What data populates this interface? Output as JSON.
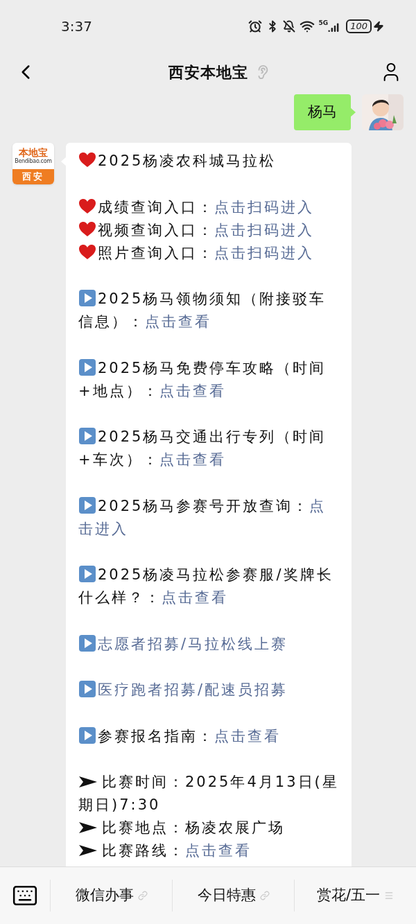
{
  "status_bar": {
    "time": "3:37",
    "network": "5G",
    "battery": "100"
  },
  "header": {
    "title": "西安本地宝"
  },
  "messages": [
    {
      "kind": "sent",
      "text": "杨马"
    },
    {
      "kind": "received",
      "avatar": {
        "brand": "本地宝",
        "domain": "Bendibao.com",
        "city": "西安"
      },
      "blocks": [
        [
          {
            "kind": "heart",
            "parts": [
              {
                "text": "2025杨凌农科城马拉松",
                "link": false
              }
            ]
          }
        ],
        [
          {
            "kind": "heart",
            "parts": [
              {
                "text": "成绩查询入口：",
                "link": false
              },
              {
                "text": "点击扫码进入",
                "link": true
              }
            ]
          },
          {
            "kind": "heart",
            "parts": [
              {
                "text": "视频查询入口：",
                "link": false
              },
              {
                "text": "点击扫码进入",
                "link": true
              }
            ]
          },
          {
            "kind": "heart",
            "parts": [
              {
                "text": "照片查询入口：",
                "link": false
              },
              {
                "text": "点击扫码进入",
                "link": true
              }
            ]
          }
        ],
        [
          {
            "kind": "play",
            "parts": [
              {
                "text": "2025杨马领物须知（附接驳车",
                "link": false
              }
            ]
          },
          {
            "kind": "continuation",
            "parts": [
              {
                "text": "信息）：",
                "link": false
              },
              {
                "text": "点击查看",
                "link": true
              }
            ]
          }
        ],
        [
          {
            "kind": "play",
            "parts": [
              {
                "text": "2025杨马免费停车攻略（时间",
                "link": false
              }
            ]
          },
          {
            "kind": "continuation",
            "parts": [
              {
                "text": "+地点）：",
                "link": false
              },
              {
                "text": "点击查看",
                "link": true
              }
            ]
          }
        ],
        [
          {
            "kind": "play",
            "parts": [
              {
                "text": "2025杨马交通出行专列（时间",
                "link": false
              }
            ]
          },
          {
            "kind": "continuation",
            "parts": [
              {
                "text": "+车次）：",
                "link": false
              },
              {
                "text": "点击查看",
                "link": true
              }
            ]
          }
        ],
        [
          {
            "kind": "play",
            "parts": [
              {
                "text": "2025杨马参赛号开放查询：",
                "link": false
              },
              {
                "text": "点",
                "link": true
              }
            ]
          },
          {
            "kind": "continuation",
            "parts": [
              {
                "text": "击进入",
                "link": true
              }
            ]
          }
        ],
        [
          {
            "kind": "play",
            "parts": [
              {
                "text": "2025杨凌马拉松参赛服/奖牌长",
                "link": false
              }
            ]
          },
          {
            "kind": "continuation",
            "parts": [
              {
                "text": "什么样？：",
                "link": false
              },
              {
                "text": "点击查看",
                "link": true
              }
            ]
          }
        ],
        [
          {
            "kind": "play",
            "parts": [
              {
                "text": "志愿者招募/马拉松线上赛",
                "link": true
              }
            ]
          }
        ],
        [
          {
            "kind": "play",
            "parts": [
              {
                "text": "医疗跑者招募/配速员招募",
                "link": true
              }
            ]
          }
        ],
        [
          {
            "kind": "play",
            "parts": [
              {
                "text": "参赛报名指南：",
                "link": false
              },
              {
                "text": "点击查看",
                "link": true
              }
            ]
          }
        ],
        [
          {
            "kind": "arrow",
            "parts": [
              {
                "text": "比赛时间：2025年4月13日(星",
                "link": false
              }
            ]
          },
          {
            "kind": "continuation",
            "parts": [
              {
                "text": "期日)7:30",
                "link": false
              }
            ]
          },
          {
            "kind": "arrow",
            "parts": [
              {
                "text": "比赛地点：杨凌农展广场",
                "link": false
              }
            ]
          },
          {
            "kind": "arrow",
            "parts": [
              {
                "text": "比赛路线：",
                "link": false
              },
              {
                "text": "点击查看",
                "link": true
              }
            ]
          }
        ]
      ]
    }
  ],
  "menu": [
    {
      "label": "微信办事",
      "kind": "link"
    },
    {
      "label": "今日特惠",
      "kind": "link"
    },
    {
      "label": "赏花/五一",
      "kind": "submenu"
    }
  ]
}
